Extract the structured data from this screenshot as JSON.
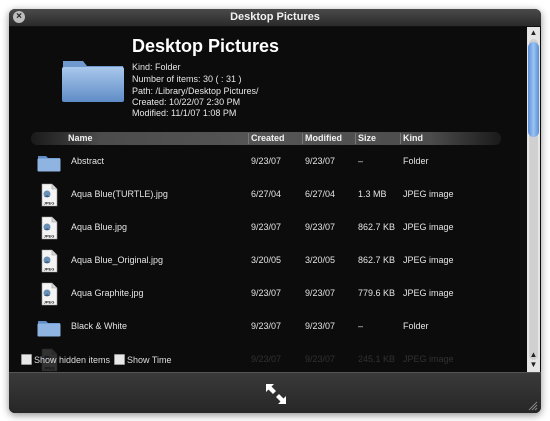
{
  "window": {
    "title": "Desktop Pictures",
    "close_icon": "×"
  },
  "header": {
    "name": "Desktop Pictures",
    "kind": "Kind: Folder",
    "items": "Number of items: 30 ( : 31 )",
    "path": "Path: /Library/Desktop Pictures/",
    "created": "Created: 10/22/07 2:30 PM",
    "modified": "Modified: 11/1/07 1:08 PM"
  },
  "columns": {
    "name": "Name",
    "created": "Created",
    "modified": "Modified",
    "size": "Size",
    "kind": "Kind"
  },
  "rows": [
    {
      "icon": "folder",
      "name": "Abstract",
      "created": "9/23/07",
      "modified": "9/23/07",
      "size": "–",
      "kind": "Folder"
    },
    {
      "icon": "jpeg",
      "name": "Aqua Blue(TURTLE).jpg",
      "created": "6/27/04",
      "modified": "6/27/04",
      "size": "1.3 MB",
      "kind": "JPEG image"
    },
    {
      "icon": "jpeg",
      "name": "Aqua Blue.jpg",
      "created": "9/23/07",
      "modified": "9/23/07",
      "size": "862.7 KB",
      "kind": "JPEG image"
    },
    {
      "icon": "jpeg",
      "name": "Aqua Blue_Original.jpg",
      "created": "3/20/05",
      "modified": "3/20/05",
      "size": "862.7 KB",
      "kind": "JPEG image"
    },
    {
      "icon": "jpeg",
      "name": "Aqua Graphite.jpg",
      "created": "9/23/07",
      "modified": "9/23/07",
      "size": "779.6 KB",
      "kind": "JPEG image"
    },
    {
      "icon": "folder",
      "name": "Black & White",
      "created": "9/23/07",
      "modified": "9/23/07",
      "size": "–",
      "kind": "Folder"
    },
    {
      "icon": "jpeg",
      "name": "",
      "created": "9/23/07",
      "modified": "9/23/07",
      "size": "245.1 KB",
      "kind": "JPEG image"
    }
  ],
  "jpeg_badge": "JPEG",
  "options": {
    "show_hidden": "Show hidden items",
    "show_time": "Show Time"
  },
  "scroll": {
    "up": "▲",
    "down": "▼"
  },
  "colors": {
    "background": "#0c0c0c",
    "scroll_thumb": "#7aa9e6",
    "folder": "#7fa8d8"
  }
}
